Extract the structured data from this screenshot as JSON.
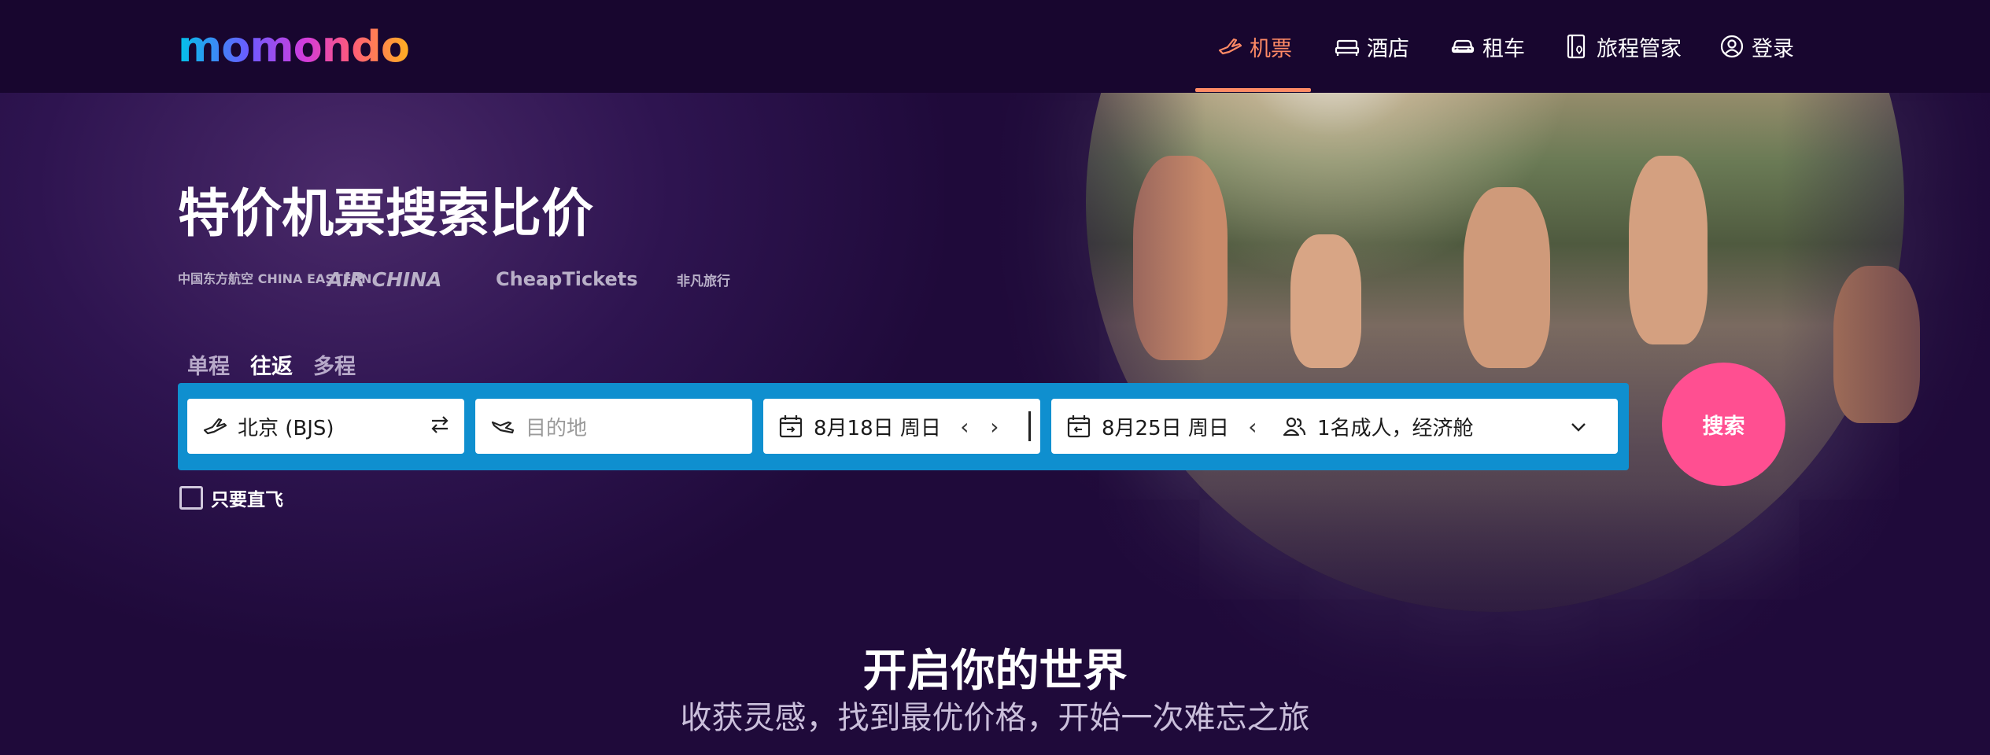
{
  "brand": {
    "name": "momondo"
  },
  "nav": [
    {
      "label": "机票",
      "icon": "plane-icon",
      "active": true
    },
    {
      "label": "酒店",
      "icon": "bed-icon",
      "active": false
    },
    {
      "label": "租车",
      "icon": "car-icon",
      "active": false
    },
    {
      "label": "旅程管家",
      "icon": "trips-icon",
      "active": false
    },
    {
      "label": "登录",
      "icon": "user-icon",
      "active": false
    }
  ],
  "hero": {
    "headline": "特价机票搜索比价",
    "partners": [
      "中国东方航空 CHINA EASTERN",
      "AIR CHINA",
      "CheapTickets",
      "非凡旅行"
    ]
  },
  "search": {
    "trip_types": [
      "单程",
      "往返",
      "多程"
    ],
    "active_trip_type": "往返",
    "origin": "北京 (BJS)",
    "destination_placeholder": "目的地",
    "depart_date": "8月18日 周日",
    "return_date": "8月25日 周日",
    "travellers": "1名成人，经济舱",
    "submit_label": "搜索",
    "direct_only_label": "只要直飞"
  },
  "promo": {
    "title": "开启你的世界",
    "subtitle": "收获灵感，找到最优价格，开始一次难忘之旅"
  },
  "colors": {
    "accent": "#ff8a65",
    "search_bar": "#0f8fcf",
    "search_button": "#ff4f91",
    "background": "#1f0a3a"
  }
}
